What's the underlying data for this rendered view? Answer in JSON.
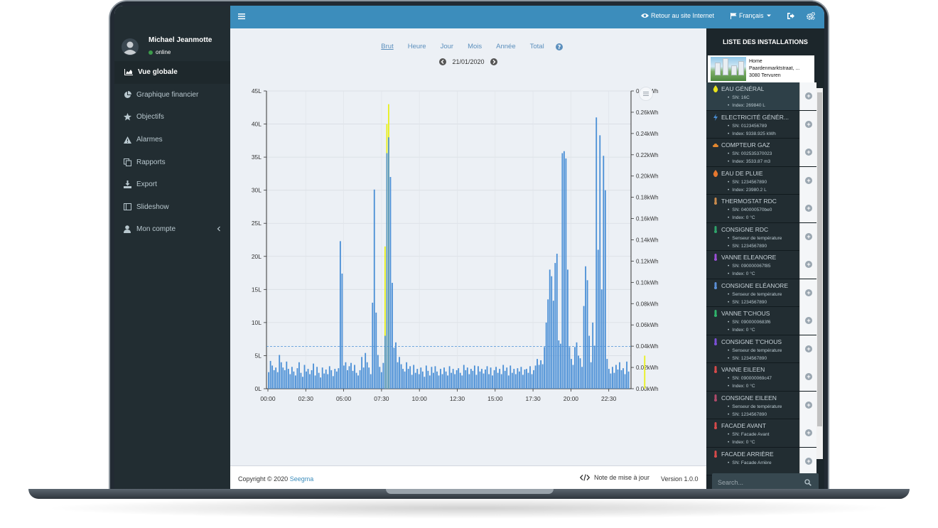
{
  "user": {
    "name": "Michael Jeanmotte",
    "status": "online"
  },
  "menu": [
    {
      "label": "Vue globale",
      "icon": "area-chart-icon",
      "active": true
    },
    {
      "label": "Graphique financier",
      "icon": "pie-chart-icon"
    },
    {
      "label": "Objectifs",
      "icon": "star-icon"
    },
    {
      "label": "Alarmes",
      "icon": "warning-icon"
    },
    {
      "label": "Rapports",
      "icon": "copy-icon"
    },
    {
      "label": "Export",
      "icon": "download-icon"
    },
    {
      "label": "Slideshow",
      "icon": "slideshow-icon"
    },
    {
      "label": "Mon compte",
      "icon": "user-icon",
      "has_children": true
    }
  ],
  "topbar": {
    "back_link": "Retour au site Internet",
    "language": "Français"
  },
  "tabs": {
    "items": [
      "Brut",
      "Heure",
      "Jour",
      "Mois",
      "Année",
      "Total"
    ],
    "active": "Brut"
  },
  "date": "21/01/2020",
  "chart_data": {
    "type": "bar",
    "left_axis": {
      "ticks": [
        "0L",
        "5L",
        "10L",
        "15L",
        "20L",
        "25L",
        "30L",
        "35L",
        "40L",
        "45L"
      ],
      "min": 0,
      "max": 45
    },
    "right_axis": {
      "ticks": [
        "0.00kWh",
        "0.02kWh",
        "0.04kWh",
        "0.06kWh",
        "0.08kWh",
        "0.10kWh",
        "0.12kWh",
        "0.14kWh",
        "0.16kWh",
        "0.18kWh",
        "0.20kWh",
        "0.22kWh",
        "0.24kWh",
        "0.26kWh",
        "0.28kWh"
      ],
      "min": 0,
      "max": 0.28
    },
    "x_ticks": [
      "00:00",
      "02:30",
      "05:00",
      "07:30",
      "10:00",
      "12:30",
      "15:00",
      "17:30",
      "20:00",
      "22:30"
    ],
    "threshold": 6.4,
    "series": [
      {
        "color": "#4a8fd6",
        "values": [
          2.5,
          4.2,
          3.5,
          2.8,
          3.2,
          2.5,
          5.1,
          4.0,
          3.2,
          2.8,
          4.1,
          3.0,
          2.2,
          3.3,
          2.6,
          2.0,
          3.1,
          4.0,
          2.4,
          1.8,
          3.6,
          2.6,
          3.0,
          2.2,
          2.8,
          3.8,
          2.0,
          3.3,
          2.4,
          1.7,
          3.2,
          2.3,
          2.9,
          2.2,
          3.4,
          2.8,
          1.9,
          3.0,
          2.6,
          3.1,
          22.3,
          17.4,
          3.5,
          4.0,
          2.8,
          3.4,
          3.9,
          2.7,
          3.6,
          2.4,
          2.0,
          2.8,
          4.8,
          3.2,
          5.4,
          4.0,
          3.2,
          2.2,
          13.0,
          30.1,
          11.5,
          5.1,
          3.3,
          2.5,
          3.9,
          8.0,
          35.6,
          38.0,
          32.0,
          16.0,
          6.2,
          7.0,
          4.0,
          4.8,
          3.7,
          3.0,
          2.6,
          4.0,
          3.0,
          3.4,
          2.1,
          3.6,
          2.4,
          3.0,
          2.2,
          3.2,
          2.6,
          1.8,
          3.5,
          2.7,
          2.0,
          3.3,
          2.4,
          3.4,
          2.6,
          2.0,
          3.0,
          2.2,
          3.2,
          2.6,
          2.0,
          3.4,
          2.4,
          3.0,
          2.2,
          2.8,
          3.1,
          2.4,
          2.0,
          3.6,
          2.8,
          3.2,
          2.2,
          3.0,
          2.7,
          3.5,
          2.1,
          3.4,
          2.6,
          3.0,
          2.3,
          2.9,
          3.4,
          2.2,
          3.2,
          2.0,
          2.8,
          3.3,
          2.4,
          3.0,
          2.2,
          3.6,
          2.7,
          3.2,
          2.0,
          3.5,
          2.4,
          3.0,
          2.2,
          3.1,
          2.6,
          3.3,
          2.1,
          2.9,
          3.0,
          2.4,
          3.4,
          2.2,
          2.8,
          3.5,
          4.5,
          3.6,
          4.3,
          3.7,
          6.3,
          10.0,
          13.5,
          18.0,
          17.0,
          13.3,
          19.0,
          20.4,
          7.3,
          6.8,
          35.6,
          35.9,
          34.8,
          18.0,
          6.3,
          4.5,
          3.6,
          6.3,
          7.0,
          5.0,
          4.6,
          3.3,
          12.5,
          18.5,
          16.4,
          8.0,
          4.0,
          10.0,
          6.5,
          41.0,
          21.0,
          38.3,
          15.0,
          35.2,
          30.0,
          4.5,
          3.0,
          2.3,
          3.3,
          2.4,
          3.6,
          2.9,
          4.0,
          2.8,
          3.1,
          2.2,
          4.1,
          2.6
        ]
      },
      {
        "color": "#e8f01c",
        "values": [
          0,
          0,
          0,
          0,
          0,
          0,
          0,
          0,
          0,
          0,
          0,
          0,
          0,
          0,
          0,
          0,
          0,
          0,
          0,
          0,
          0,
          0,
          0,
          0,
          0,
          0,
          0,
          0,
          0,
          0,
          0,
          0,
          0,
          0,
          0,
          0,
          0,
          0,
          0,
          0,
          0,
          0,
          0,
          0,
          0,
          0,
          0,
          0,
          0,
          0,
          0,
          0,
          0,
          0,
          0,
          0,
          0,
          0,
          0,
          0,
          0,
          0,
          0,
          0,
          0,
          21.5,
          40.0,
          43.0,
          0,
          0,
          0,
          0,
          0,
          0,
          0,
          0,
          0,
          0,
          0,
          0,
          0,
          0,
          0,
          0,
          0,
          0,
          0,
          0,
          0,
          0,
          0,
          0,
          0,
          0,
          0,
          0,
          0,
          0,
          0,
          0,
          0,
          0,
          0,
          0,
          0,
          0,
          0,
          0,
          0,
          0,
          0,
          0,
          0,
          0,
          0,
          0,
          0,
          0,
          0,
          0,
          0,
          0,
          0,
          0,
          0,
          0,
          0,
          0,
          0,
          0,
          0,
          0,
          0,
          0,
          0,
          0,
          0,
          0,
          0,
          0,
          0,
          0,
          0,
          0,
          0,
          0,
          0,
          0,
          0,
          0,
          0,
          0,
          0,
          0,
          0,
          0,
          0,
          0,
          0,
          0,
          0,
          0,
          0,
          0,
          0,
          0,
          0,
          0,
          0,
          0,
          0,
          0,
          0,
          0,
          0,
          0,
          0,
          0,
          0,
          0,
          0,
          0,
          0,
          0,
          0,
          0,
          0,
          0,
          0,
          0,
          0,
          0,
          0,
          0,
          0,
          0,
          0,
          0,
          0,
          0,
          0,
          0,
          0,
          0,
          0,
          0,
          0,
          0,
          0,
          0,
          5.0
        ]
      }
    ]
  },
  "footer": {
    "copyright_prefix": "Copyright © 2020 ",
    "company": "Seegma",
    "notes": "Note de mise à jour",
    "version": "Version 1.0.0"
  },
  "installations": {
    "title": "LISTE DES INSTALLATIONS",
    "home": {
      "line1": "Home",
      "line2": "Paardenmarktstraat, ...",
      "line3": "3080 Tervuren"
    },
    "items": [
      {
        "name": "EAU GÉNÉRAL",
        "icon": "drop-icon",
        "color": "#e8e21c",
        "sn": "SN: 16C",
        "index": "Index: 269840 L",
        "active": true
      },
      {
        "name": "ELECTRICITÉ GÉNÉR...",
        "icon": "bolt-icon",
        "color": "#4a8fd6",
        "sn": "SN: 0123456789",
        "index": "Index: 9338.925 kWh"
      },
      {
        "name": "COMPTEUR GAZ",
        "icon": "cloud-icon",
        "color": "#e0862f",
        "sn": "SN: 002535370023",
        "index": "Index: 3533.87 m3"
      },
      {
        "name": "EAU DE PLUIE",
        "icon": "drop-icon",
        "color": "#e6772e",
        "sn": "SN: 1234567890",
        "index": "Index: 23980.2 L"
      },
      {
        "name": "THERMOSTAT RDC",
        "icon": "thermometer-icon",
        "color": "#c98a4c",
        "sn": "SN: 040000570be0",
        "index": "Index: 0 °C"
      },
      {
        "name": "CONSIGNE RDC",
        "icon": "thermometer-icon",
        "color": "#2fa36a",
        "sn": "Senseur de température",
        "index": "SN: 1234567890"
      },
      {
        "name": "VANNE ELEANORE",
        "icon": "thermometer-icon",
        "color": "#9b4fd6",
        "sn": "SN: 090000067f85",
        "index": "Index: 0 °C"
      },
      {
        "name": "CONSIGNE ELÉANORE",
        "icon": "thermometer-icon",
        "color": "#5b8fd6",
        "sn": "Senseur de température",
        "index": "SN: 1234567890"
      },
      {
        "name": "VANNE T'CHOUS",
        "icon": "thermometer-icon",
        "color": "#2fb36a",
        "sn": "SN: 0900000683f6",
        "index": "Index: 0 °C"
      },
      {
        "name": "CONSIGNE T'CHOUS",
        "icon": "thermometer-icon",
        "color": "#7b4fd6",
        "sn": "Senseur de température",
        "index": "SN: 1234567890"
      },
      {
        "name": "VANNE EILEEN",
        "icon": "thermometer-icon",
        "color": "#d64a4a",
        "sn": "SN: 090000069c47",
        "index": "Index: 0 °C"
      },
      {
        "name": "CONSIGNE EILEEN",
        "icon": "thermometer-icon",
        "color": "#b04a6a",
        "sn": "Senseur de température",
        "index": "SN: 1234567890"
      },
      {
        "name": "FACADE AVANT",
        "icon": "thermometer-icon",
        "color": "#d64a4a",
        "sn": "SN: Facade Avant",
        "index": "Index: 0 °C"
      },
      {
        "name": "FACADE ARRIÈRE",
        "icon": "thermometer-icon",
        "color": "#d64a4a",
        "sn": "SN: Facade Arrière",
        "index": ""
      }
    ],
    "search_placeholder": "Search..."
  }
}
